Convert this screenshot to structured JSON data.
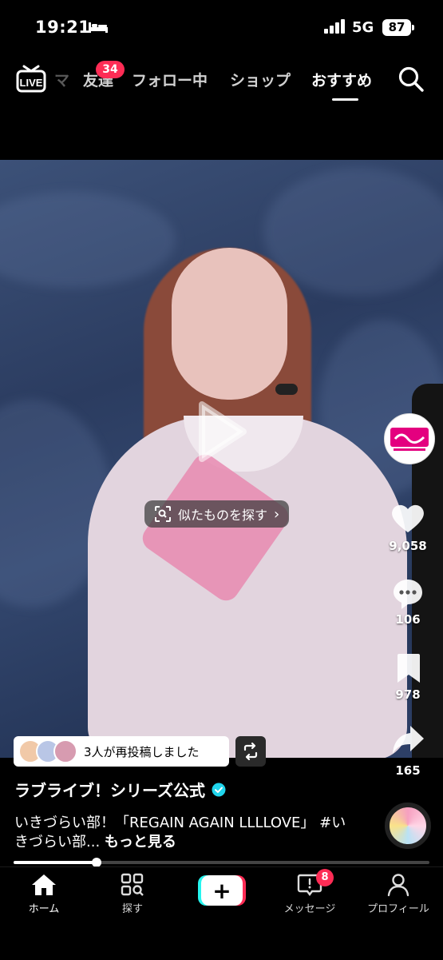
{
  "status_bar": {
    "time": "19:21",
    "network": "5G",
    "battery": "87"
  },
  "top_nav": {
    "partial_tab": "マ",
    "tabs": [
      {
        "label": "友達",
        "badge": "34"
      },
      {
        "label": "フォロー中"
      },
      {
        "label": "ショップ"
      },
      {
        "label": "おすすめ",
        "active": true
      }
    ]
  },
  "video": {
    "similar_button": "似たものを探す",
    "right_rail": {
      "likes": "9,058",
      "comments": "106",
      "saves": "978",
      "shares": "165"
    },
    "repost": {
      "text": "3人が再投稿しました"
    },
    "creator": {
      "name": "ラブライブ！シリーズ公式",
      "verified": true
    },
    "caption": {
      "text": "いきづらい部！「REGAIN AGAIN LLLLOVE」 #いきづらい部...",
      "more": "もっと見る"
    },
    "progress_fraction": 0.2
  },
  "bottom_nav": {
    "items": [
      {
        "label": "ホーム",
        "active": true
      },
      {
        "label": "探す"
      },
      {
        "label": "メッセージ",
        "badge": "8"
      },
      {
        "label": "プロフィール"
      }
    ]
  },
  "colors": {
    "accent": "#fe2c55",
    "cyan": "#25f4ee",
    "verified": "#20d5ec"
  }
}
